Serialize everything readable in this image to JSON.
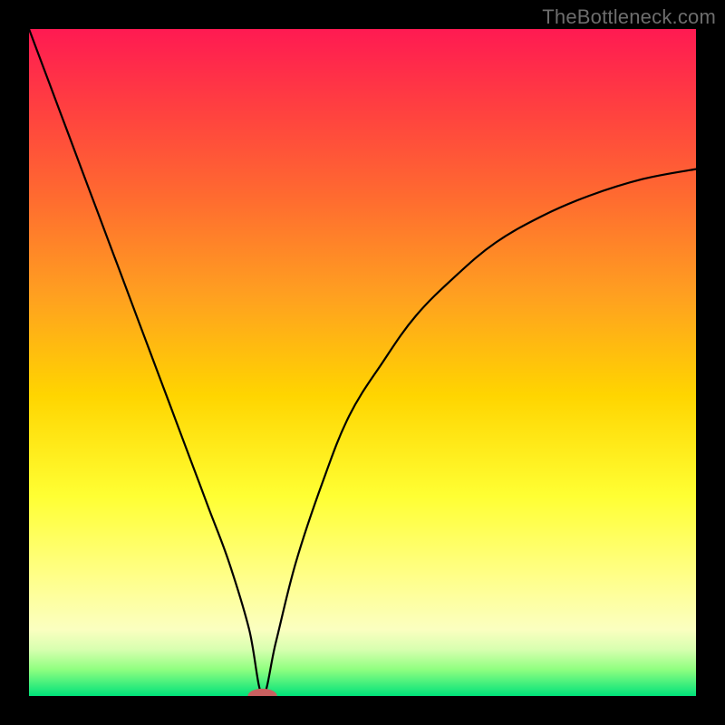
{
  "watermark": "TheBottleneck.com",
  "colors": {
    "frame": "#000000",
    "gradient_stops": [
      {
        "pos": 0.0,
        "color": "#ff1a52"
      },
      {
        "pos": 0.12,
        "color": "#ff4040"
      },
      {
        "pos": 0.25,
        "color": "#ff6a30"
      },
      {
        "pos": 0.4,
        "color": "#ffa020"
      },
      {
        "pos": 0.55,
        "color": "#ffd500"
      },
      {
        "pos": 0.7,
        "color": "#ffff33"
      },
      {
        "pos": 0.82,
        "color": "#ffff88"
      },
      {
        "pos": 0.9,
        "color": "#fbffc0"
      },
      {
        "pos": 0.93,
        "color": "#d8ffb0"
      },
      {
        "pos": 0.96,
        "color": "#90ff80"
      },
      {
        "pos": 1.0,
        "color": "#00e27a"
      }
    ],
    "curve": "#000000",
    "marker": "#c96060"
  },
  "chart_data": {
    "type": "line",
    "title": "",
    "xlabel": "",
    "ylabel": "",
    "xlim": [
      0,
      100
    ],
    "ylim": [
      0,
      100
    ],
    "notch_x": 35,
    "marker": {
      "x": 35,
      "y": 0,
      "rx": 2.2,
      "ry": 1.1
    },
    "series": [
      {
        "name": "bottleneck-curve",
        "x": [
          0,
          3,
          6,
          9,
          12,
          15,
          18,
          21,
          24,
          27,
          30,
          33,
          35,
          37,
          40,
          44,
          48,
          53,
          58,
          64,
          70,
          77,
          84,
          92,
          100
        ],
        "y": [
          100,
          92,
          84,
          76,
          68,
          60,
          52,
          44,
          36,
          28,
          20,
          10,
          0.2,
          8,
          20,
          32,
          42,
          50,
          57,
          63,
          68,
          72,
          75,
          77.5,
          79
        ]
      }
    ]
  }
}
